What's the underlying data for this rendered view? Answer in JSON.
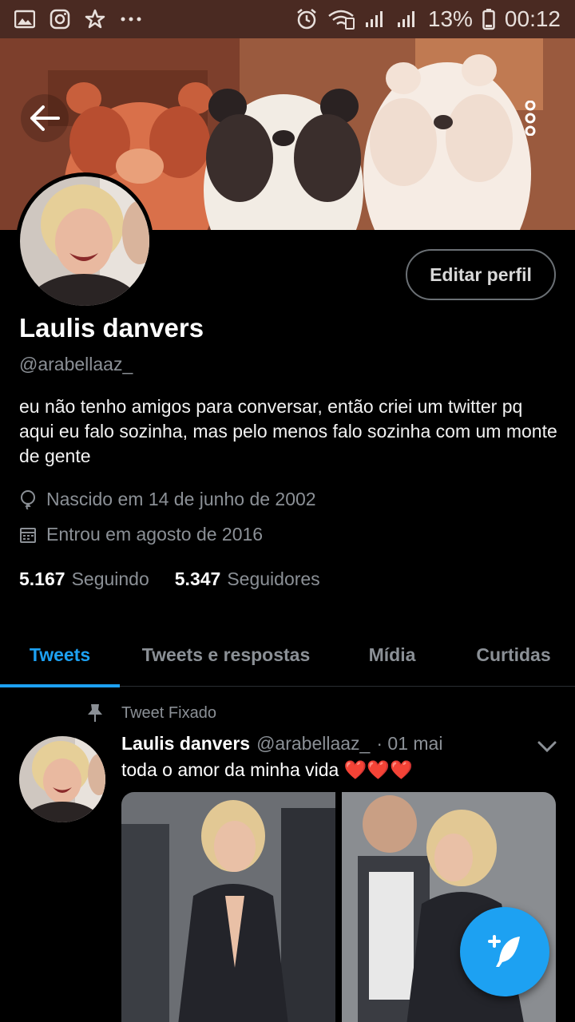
{
  "status_bar": {
    "battery": "13%",
    "time": "00:12",
    "left_icons": [
      "gallery-icon",
      "instagram-icon",
      "star-icon",
      "more-dots-icon"
    ],
    "right_icons": [
      "alarm-icon",
      "wifi-icon",
      "signal-icon",
      "signal-icon",
      "battery-icon"
    ]
  },
  "header": {
    "back_icon": "arrow-left-icon",
    "more_icon": "vertical-dots-icon"
  },
  "profile": {
    "edit_button": "Editar perfil",
    "display_name": "Laulis danvers",
    "handle": "@arabellaaz_",
    "bio": "eu não tenho amigos para conversar, então criei um twitter pq aqui eu falo sozinha, mas pelo menos falo sozinha com um monte de gente",
    "birth": "Nascido em 14 de junho de 2002",
    "joined": "Entrou em agosto de 2016",
    "following_count": "5.167",
    "following_label": "Seguindo",
    "followers_count": "5.347",
    "followers_label": "Seguidores"
  },
  "tabs": [
    {
      "label": "Tweets",
      "active": true
    },
    {
      "label": "Tweets e respostas",
      "active": false
    },
    {
      "label": "Mídia",
      "active": false
    },
    {
      "label": "Curtidas",
      "active": false
    }
  ],
  "pinned_tweet": {
    "pinned_label": "Tweet Fixado",
    "author_name": "Laulis danvers",
    "author_handle": "@arabellaaz_",
    "date": "· 01 mai",
    "text": "toda o amor da minha vida ❤️❤️❤️"
  },
  "colors": {
    "accent": "#1da1f2",
    "background": "#000000",
    "muted_text": "#8b9096",
    "status_bar": "#4a2a22"
  }
}
